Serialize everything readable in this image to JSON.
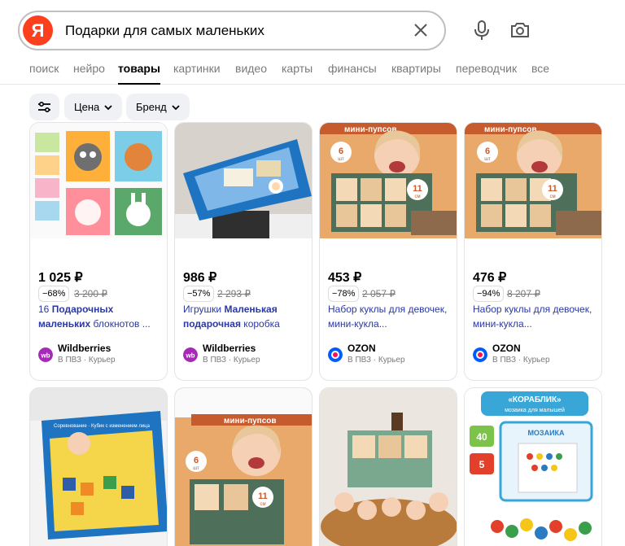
{
  "search": {
    "logo": "Я",
    "query": "Подарки для самых маленьких"
  },
  "tabs": [
    "поиск",
    "нейро",
    "товары",
    "картинки",
    "видео",
    "карты",
    "финансы",
    "квартиры",
    "переводчик",
    "все"
  ],
  "active_tab": "товары",
  "filters": {
    "price": "Цена",
    "brand": "Бренд"
  },
  "products": [
    {
      "price": "1 025 ₽",
      "discount": "−68%",
      "old_price": "3 200 ₽",
      "title_pre": "16 ",
      "title_bold": "Подарочных маленьких",
      "title_post": " блокнотов ...",
      "shop": "Wildberries",
      "delivery": "В ПВЗ · Курьер"
    },
    {
      "price": "986 ₽",
      "discount": "−57%",
      "old_price": "2 293 ₽",
      "title_pre": "Игрушки ",
      "title_bold": "Маленькая подарочная",
      "title_post": " коробка",
      "shop": "Wildberries",
      "delivery": "В ПВЗ · Курьер"
    },
    {
      "price": "453 ₽",
      "discount": "−78%",
      "old_price": "2 057 ₽",
      "title_pre": "Набор куклы для девочек, мини-кукла...",
      "title_bold": "",
      "title_post": "",
      "shop": "OZON",
      "delivery": "В ПВЗ · Курьер"
    },
    {
      "price": "476 ₽",
      "discount": "−94%",
      "old_price": "8 207 ₽",
      "title_pre": "Набор куклы для девочек, мини-кукла...",
      "title_bold": "",
      "title_post": "",
      "shop": "OZON",
      "delivery": "В ПВЗ · Курьер"
    }
  ],
  "image_text": {
    "dolls_banner": "мини-пупсов",
    "dolls_count": "6",
    "dolls_count_unit": "шт",
    "dolls_size": "11",
    "dolls_size_unit": "см",
    "box_label": "Соревнование · Кубик с изменением лица",
    "mosaic_brand": "«КОРАБЛИК»",
    "mosaic_sub": "мозаика для малышей",
    "mosaic_word": "МОЗАИКА",
    "mosaic_pieces": "40",
    "mosaic_colors": "5"
  },
  "colors": {
    "logo": "#fc3f1d",
    "link": "#2a38a4",
    "wb": "#a52ab5",
    "ozon": "#005bff"
  }
}
